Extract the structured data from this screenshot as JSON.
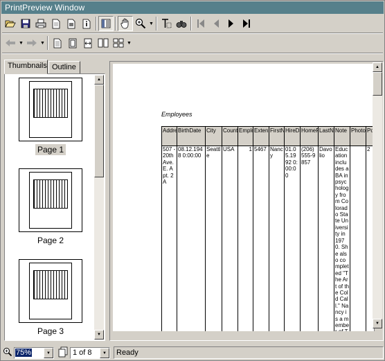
{
  "window": {
    "title": "PrintPreview Window"
  },
  "toolbar1": {
    "items": [
      {
        "name": "open-icon"
      },
      {
        "name": "save-icon"
      },
      {
        "name": "print-icon"
      },
      {
        "name": "page-setup-icon"
      },
      {
        "name": "export-icon"
      },
      {
        "name": "info-icon"
      },
      {
        "name": "sep"
      },
      {
        "name": "thumbnails-toggle-icon"
      },
      {
        "name": "sep"
      },
      {
        "name": "hand-tool-icon"
      },
      {
        "name": "zoom-tool-icon"
      },
      {
        "name": "zoom-dropdown"
      },
      {
        "name": "sep"
      },
      {
        "name": "text-select-icon"
      },
      {
        "name": "find-icon"
      },
      {
        "name": "sep"
      },
      {
        "name": "first-page-icon"
      },
      {
        "name": "previous-page-icon"
      },
      {
        "name": "next-page-icon"
      },
      {
        "name": "last-page-icon"
      }
    ]
  },
  "toolbar2": {
    "items": [
      {
        "name": "back-icon"
      },
      {
        "name": "back-dropdown"
      },
      {
        "name": "forward-icon"
      },
      {
        "name": "forward-dropdown"
      },
      {
        "name": "sep"
      },
      {
        "name": "single-page-view-icon"
      },
      {
        "name": "fit-page-icon"
      },
      {
        "name": "page-width-icon"
      },
      {
        "name": "two-pages-view-icon"
      },
      {
        "name": "multi-page-view-icon"
      },
      {
        "name": "multi-page-dropdown"
      }
    ]
  },
  "tabs": {
    "thumbnails": "Thumbnails",
    "outline": "Outline"
  },
  "thumbnails": [
    "Page 1",
    "Page 2",
    "Page 3"
  ],
  "report": {
    "title": "Employees",
    "columns": [
      {
        "header": "Address",
        "value": "507 - 20th Ave. E. Apt. 2A"
      },
      {
        "header": "BirthDate",
        "value": "08.12.1948 0:00:00"
      },
      {
        "header": "City",
        "value": "Seattle"
      },
      {
        "header": "Country",
        "value": "USA"
      },
      {
        "header": "EmployeeID",
        "value": "1"
      },
      {
        "header": "Extension",
        "value": "5467"
      },
      {
        "header": "FirstName",
        "value": "Nancy"
      },
      {
        "header": "HireDate",
        "value": "01.05.1992 0:00:00"
      },
      {
        "header": "HomePhone",
        "value": "(206) 555-9857"
      },
      {
        "header": "LastName",
        "value": "Davolio"
      },
      {
        "header": "Note",
        "value": "Education includes a BA in psychology from Colorado State University in 1970. She also completed \"The Art of the Cold Call.\" Nancy is a member of Toastmasters"
      },
      {
        "header": "Photo",
        "value": ""
      },
      {
        "header": "Po",
        "value": "2"
      }
    ]
  },
  "status": {
    "zoom": "75%",
    "page_indicator": "1 of 8",
    "message": "Ready"
  }
}
